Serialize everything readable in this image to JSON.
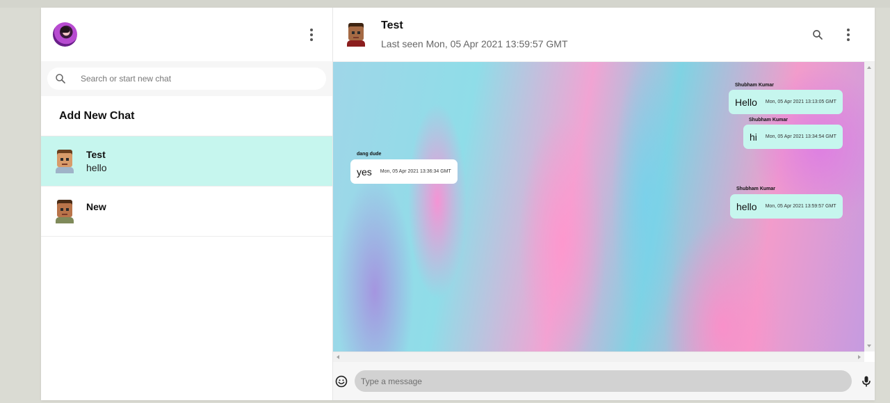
{
  "sidebar": {
    "search_placeholder": "Search or start new chat",
    "add_new_chat": "Add New Chat",
    "chats": [
      {
        "name": "Test",
        "last_message": "hello",
        "active": true
      },
      {
        "name": "New",
        "last_message": "",
        "active": false
      }
    ]
  },
  "chat": {
    "title": "Test",
    "last_seen": "Last seen Mon, 05 Apr 2021 13:59:57 GMT",
    "messages": [
      {
        "sender": "Shubham Kumar",
        "text": "Hello",
        "time": "Mon, 05 Apr 2021 13:13:05 GMT",
        "direction": "out"
      },
      {
        "sender": "Shubham Kumar",
        "text": "hi",
        "time": "Mon, 05 Apr 2021 13:34:54 GMT",
        "direction": "out"
      },
      {
        "sender": "dang dude",
        "text": "yes",
        "time": "Mon, 05 Apr 2021 13:36:34 GMT",
        "direction": "in"
      },
      {
        "sender": "Shubham Kumar",
        "text": "hello",
        "time": "Mon, 05 Apr 2021 13:59:57 GMT",
        "direction": "out"
      }
    ],
    "input_placeholder": "Type a message"
  },
  "colors": {
    "active_chat_bg": "#c6f6ee",
    "outgoing_bubble": "#c6f6ee",
    "incoming_bubble": "#ffffff",
    "input_bg": "#d2d2d2"
  },
  "icons": [
    "avatar",
    "more-vert-icon",
    "search-icon",
    "emoji-icon",
    "mic-icon"
  ]
}
